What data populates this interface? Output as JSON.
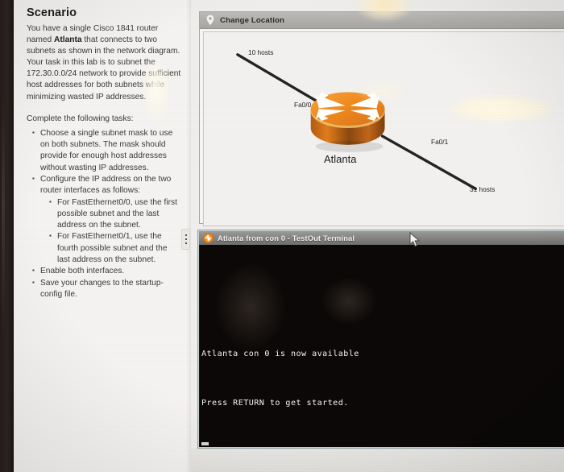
{
  "scenario": {
    "title": "Scenario",
    "intro_pre": "You have a single Cisco 1841 router named ",
    "intro_bold": "Atlanta",
    "intro_post": " that connects to two subnets as shown in the network diagram. Your task in this lab is to subnet the 172.30.0.0/24 network to provide sufficient host addresses for both subnets while minimizing wasted IP addresses.",
    "complete_label": "Complete the following tasks:",
    "tasks": [
      "Choose a single subnet mask to use on both subnets. The mask should provide for enough host addresses without wasting IP addresses.",
      "Configure the IP address on the two router interfaces as follows:",
      "Enable both interfaces.",
      "Save your changes to the startup-config file."
    ],
    "subtasks": [
      "For FastEthernet0/0, use the first possible subnet and the last address on the subnet.",
      "For FastEthernet0/1, use the fourth possible subnet and the last address on the subnet."
    ]
  },
  "diagram_panel": {
    "title": "Change Location",
    "pin_icon": "location-pin-icon",
    "labels": {
      "subnet_left": "10 hosts",
      "interface_left": "Fa0/0",
      "router_name": "Atlanta",
      "interface_right": "Fa0/1",
      "subnet_right": "31 hosts"
    },
    "router_icon": "cisco-router-icon",
    "router_color": "#f08020"
  },
  "terminal": {
    "title": "Atlanta from con 0 - TestOut Terminal",
    "icon": "router-icon",
    "lines": [
      "Atlanta con 0 is now available",
      "Press RETURN to get started."
    ],
    "bg_color": "#0b0807",
    "text_color": "#f4f4f4"
  },
  "cursor": {
    "icon": "arrow-cursor"
  }
}
